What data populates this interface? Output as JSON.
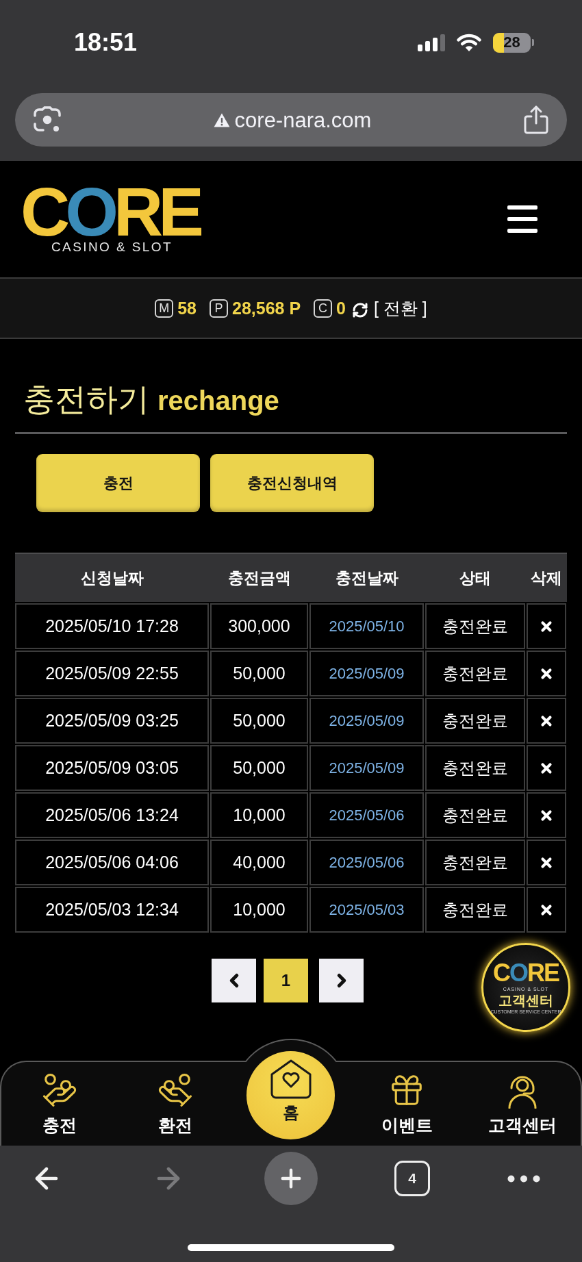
{
  "status_bar": {
    "time": "18:51",
    "battery": "28"
  },
  "address_bar": {
    "url": "core-nara.com"
  },
  "header": {
    "logo_wordmark": "CORE",
    "logo_tagline": "CASINO & SLOT"
  },
  "balances": [
    {
      "badge": "M",
      "value": "58"
    },
    {
      "badge": "P",
      "value": "28,568 P"
    },
    {
      "badge": "C",
      "value": "0"
    }
  ],
  "convert_link": "[ 전환 ]",
  "page_title": {
    "main": "충전하기",
    "sub": "rechange"
  },
  "action_buttons": [
    "충전",
    "충전신청내역"
  ],
  "table": {
    "columns": [
      "신청날짜",
      "충전금액",
      "충전날짜",
      "상태",
      "삭제"
    ],
    "rows": [
      {
        "requested_at": "2025/05/10 17:28",
        "amount": "300,000",
        "charged_on": "2025/05/10",
        "status": "충전완료"
      },
      {
        "requested_at": "2025/05/09 22:55",
        "amount": "50,000",
        "charged_on": "2025/05/09",
        "status": "충전완료"
      },
      {
        "requested_at": "2025/05/09 03:25",
        "amount": "50,000",
        "charged_on": "2025/05/09",
        "status": "충전완료"
      },
      {
        "requested_at": "2025/05/09 03:05",
        "amount": "50,000",
        "charged_on": "2025/05/09",
        "status": "충전완료"
      },
      {
        "requested_at": "2025/05/06 13:24",
        "amount": "10,000",
        "charged_on": "2025/05/06",
        "status": "충전완료"
      },
      {
        "requested_at": "2025/05/06 04:06",
        "amount": "40,000",
        "charged_on": "2025/05/06",
        "status": "충전완료"
      },
      {
        "requested_at": "2025/05/03 12:34",
        "amount": "10,000",
        "charged_on": "2025/05/03",
        "status": "충전완료"
      }
    ]
  },
  "pagination": {
    "pages": [
      {
        "label": "1",
        "selected": true
      }
    ]
  },
  "support_badge": {
    "wordmark": "CORE",
    "tagline": "CASINO & SLOT",
    "label": "고객센터",
    "caption": "CUSTOMER SERVICE CENTER"
  },
  "bottom_nav": [
    {
      "label": "충전",
      "kind": "deposit"
    },
    {
      "label": "환전",
      "kind": "withdraw"
    },
    {
      "label": "홈",
      "kind": "home"
    },
    {
      "label": "이벤트",
      "kind": "event"
    },
    {
      "label": "고객센터",
      "kind": "support"
    }
  ],
  "browser_toolbar": {
    "back_disabled": false,
    "forward_disabled": true,
    "tab_count": "4"
  }
}
